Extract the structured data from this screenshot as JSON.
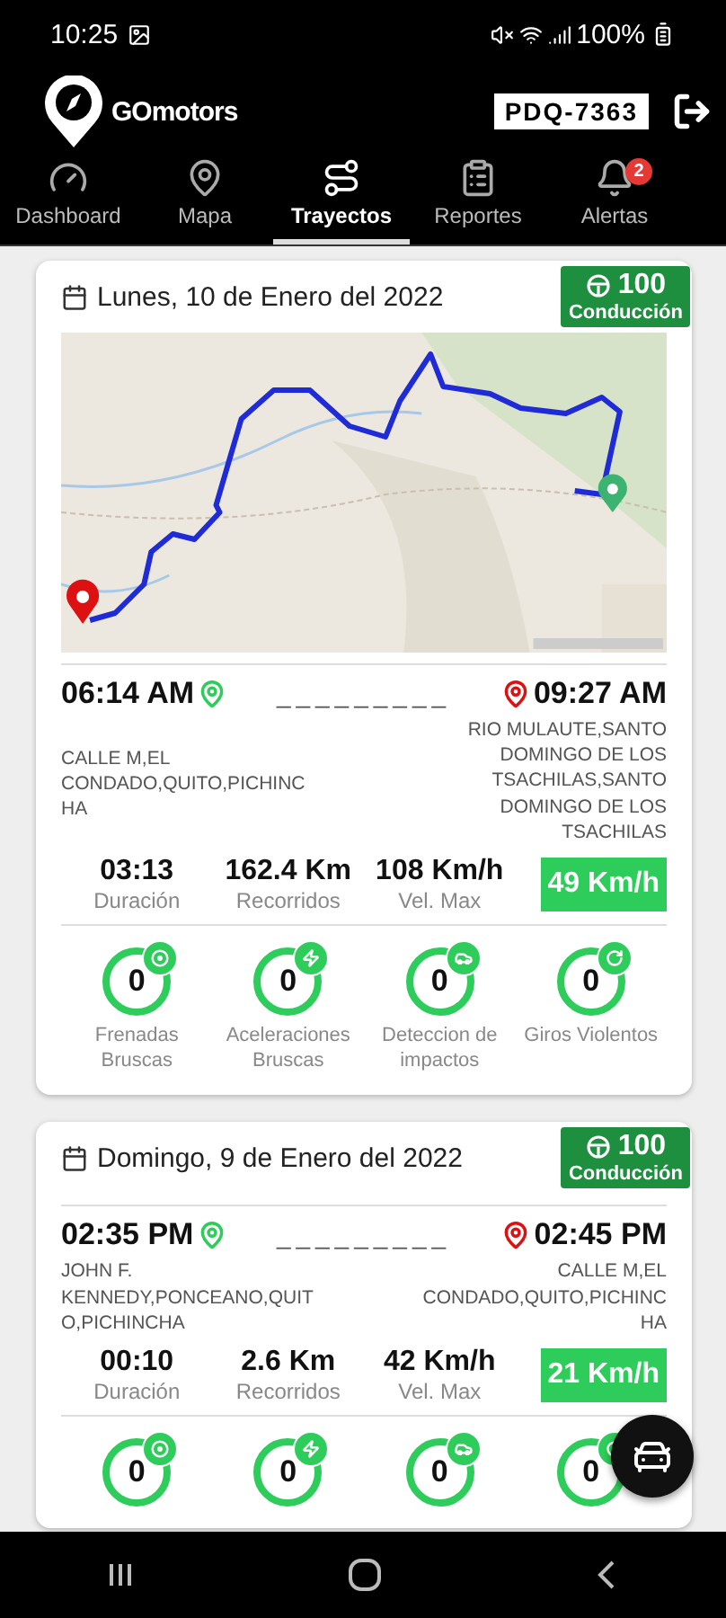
{
  "status_bar": {
    "time": "10:25",
    "battery": "100%"
  },
  "header": {
    "brand": "GOmotors",
    "plate": "PDQ-7363"
  },
  "tabs": [
    {
      "label": "Dashboard",
      "selected": false
    },
    {
      "label": "Mapa",
      "selected": false
    },
    {
      "label": "Trayectos",
      "selected": true
    },
    {
      "label": "Reportes",
      "selected": false
    },
    {
      "label": "Alertas",
      "selected": false,
      "badge": "2"
    }
  ],
  "trips": [
    {
      "date": "Lunes, 10 de Enero del 2022",
      "score": "100",
      "score_label": "Conducción",
      "map": {
        "kind": "picture"
      },
      "start_time": "06:14 AM",
      "end_time": "09:27 AM",
      "separator": "_________",
      "start_address": "CALLE M,EL CONDADO,QUITO,PICHINCHA",
      "end_address": "RIO MULAUTE,SANTO DOMINGO DE LOS TSACHILAS,SANTO DOMINGO DE LOS TSACHILAS",
      "stats": [
        {
          "value": "03:13",
          "label": "Duración"
        },
        {
          "value": "162.4 Km",
          "label": "Recorridos"
        },
        {
          "value": "108 Km/h",
          "label": "Vel. Max"
        }
      ],
      "avg_speed": "49 Km/h",
      "events": [
        {
          "count": "0",
          "label": "Frenadas Bruscas"
        },
        {
          "count": "0",
          "label": "Aceleraciones Bruscas"
        },
        {
          "count": "0",
          "label": "Deteccion de impactos"
        },
        {
          "count": "0",
          "label": "Giros Violentos"
        }
      ]
    },
    {
      "date": "Domingo, 9 de Enero del 2022",
      "score": "100",
      "score_label": "Conducción",
      "start_time": "02:35 PM",
      "end_time": "02:45 PM",
      "separator": "_________",
      "start_address": "JOHN F. KENNEDY,PONCEANO,QUITO,PICHINCHA",
      "end_address": "CALLE M,EL CONDADO,QUITO,PICHINCHA",
      "stats": [
        {
          "value": "00:10",
          "label": "Duración"
        },
        {
          "value": "2.6 Km",
          "label": "Recorridos"
        },
        {
          "value": "42 Km/h",
          "label": "Vel. Max"
        }
      ],
      "avg_speed": "21 Km/h",
      "events": [
        {
          "count": "0"
        },
        {
          "count": "0"
        },
        {
          "count": "0"
        },
        {
          "count": "0"
        }
      ]
    }
  ]
}
